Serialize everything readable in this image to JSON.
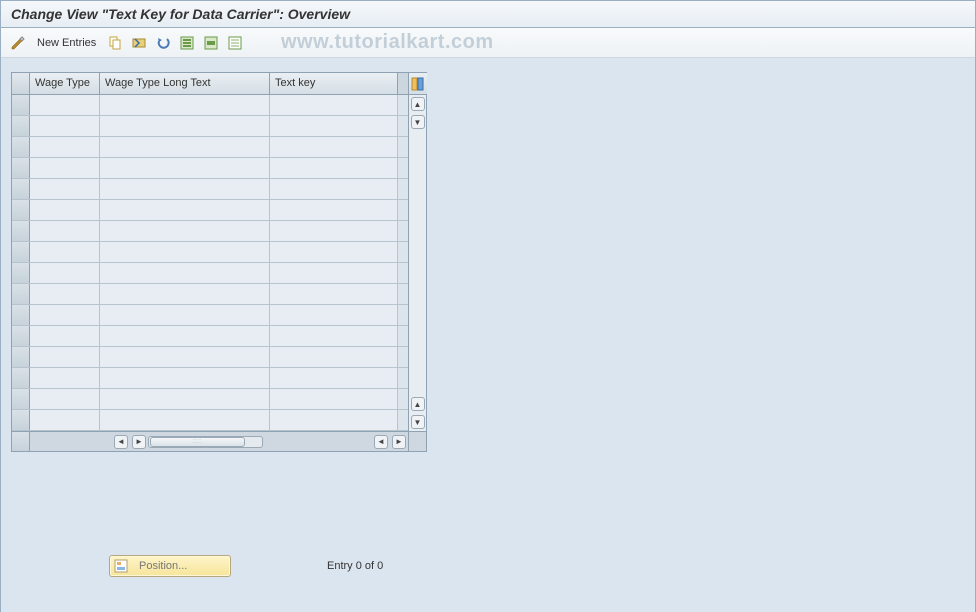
{
  "title": "Change View \"Text Key for Data Carrier\": Overview",
  "toolbar": {
    "new_entries_label": "New Entries"
  },
  "watermark": "www.tutorialkart.com",
  "table": {
    "columns": {
      "c1": "Wage Type",
      "c2": "Wage Type Long Text",
      "c3": "Text key"
    },
    "row_count": 16
  },
  "footer": {
    "position_label": "Position...",
    "entry_text": "Entry 0 of 0"
  }
}
